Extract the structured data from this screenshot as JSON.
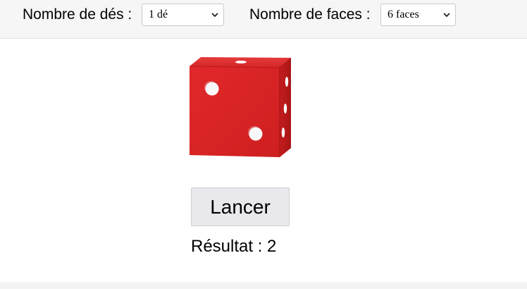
{
  "toolbar": {
    "dice_count_label": "Nombre de dés :",
    "dice_count_value": "1 dé",
    "faces_label": "Nombre de faces :",
    "faces_value": "6 faces"
  },
  "die": {
    "face_value": 2,
    "icon": "die-face-two-icon",
    "color": "#d92324"
  },
  "roll_button": {
    "label": "Lancer"
  },
  "result": {
    "text": "Résultat : 2",
    "value": 2
  }
}
